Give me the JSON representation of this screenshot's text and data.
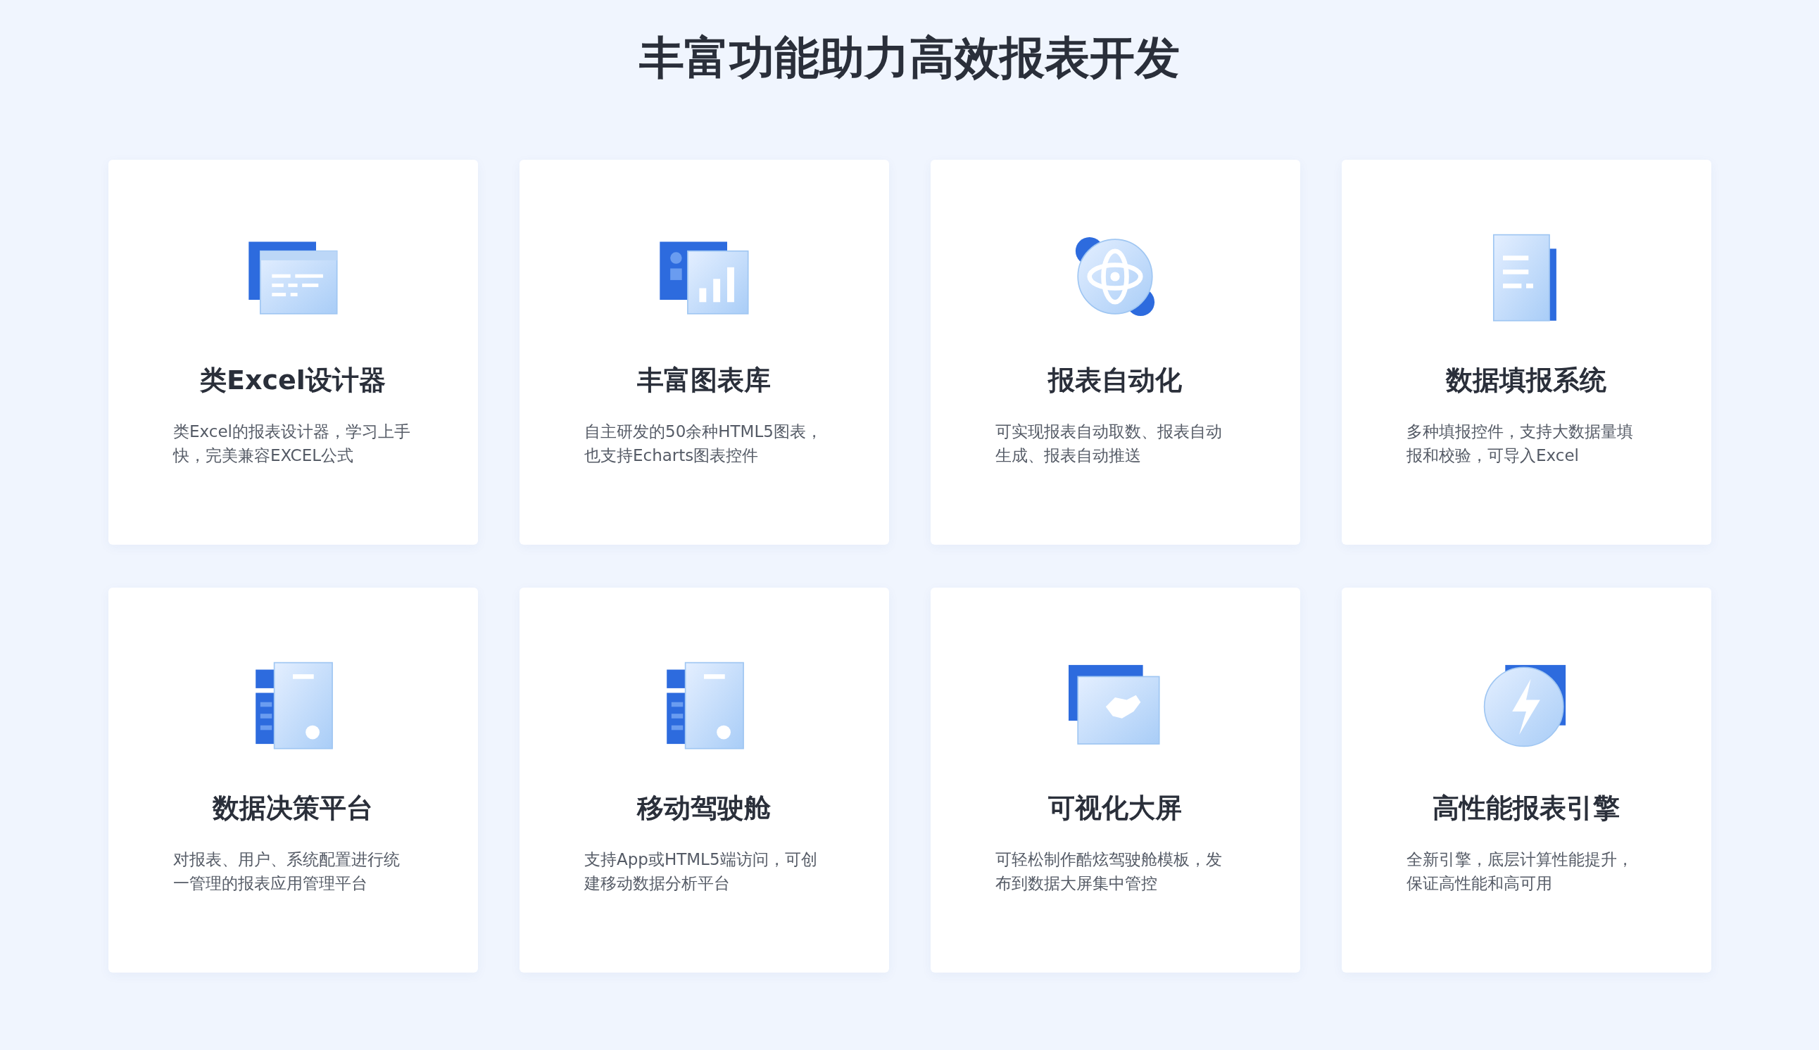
{
  "title": "丰富功能助力高效报表开发",
  "cards": [
    {
      "title": "类Excel设计器",
      "description": "类Excel的报表设计器，学习上手快，完美兼容EXCEL公式"
    },
    {
      "title": "丰富图表库",
      "description": "自主研发的50余种HTML5图表，也支持Echarts图表控件"
    },
    {
      "title": "报表自动化",
      "description": "可实现报表自动取数、报表自动生成、报表自动推送"
    },
    {
      "title": "数据填报系统",
      "description": "多种填报控件，支持大数据量填报和校验，可导入Excel"
    },
    {
      "title": "数据决策平台",
      "description": "对报表、用户、系统配置进行统一管理的报表应用管理平台"
    },
    {
      "title": "移动驾驶舱",
      "description": "支持App或HTML5端访问，可创建移动数据分析平台"
    },
    {
      "title": "可视化大屏",
      "description": "可轻松制作酷炫驾驶舱模板，发布到数据大屏集中管控"
    },
    {
      "title": "高性能报表引擎",
      "description": "全新引擎，底层计算性能提升，保证高性能和高可用"
    }
  ]
}
